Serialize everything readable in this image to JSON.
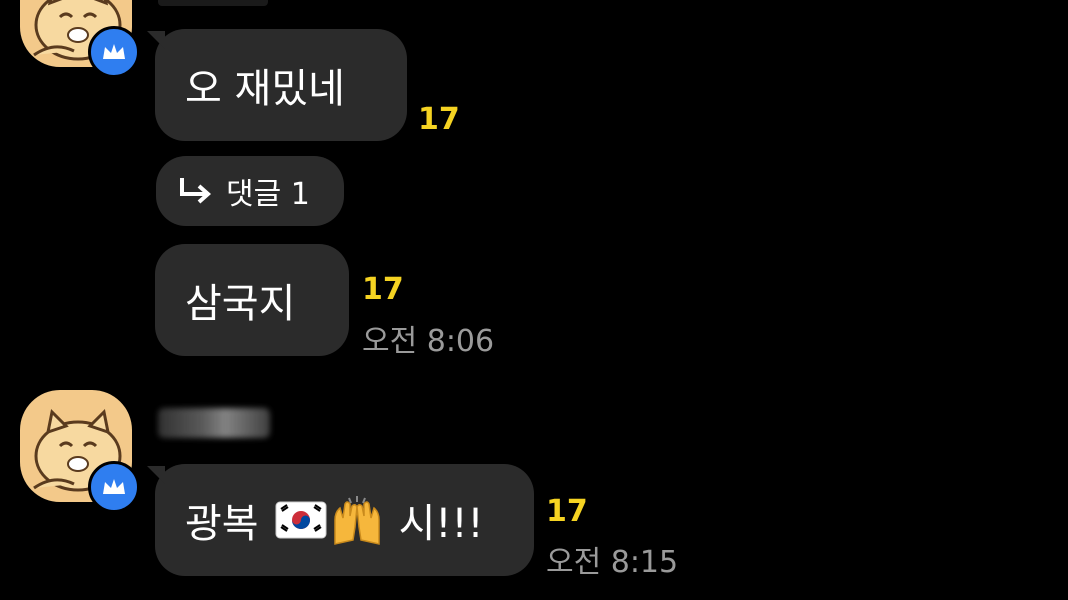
{
  "colors": {
    "background": "#000000",
    "bubble": "#2b2b2b",
    "unread": "#f5d322",
    "badge": "#2f7ef0",
    "avatar": "#f3c98a"
  },
  "messages": [
    {
      "text": "오 재밌네",
      "unread": "17"
    },
    {
      "reply_label": "댓글 1",
      "reply_icon": "reply-arrow-icon"
    },
    {
      "text": "삼국지",
      "unread": "17",
      "time": "오전 8:06"
    }
  ],
  "second_sender": {
    "avatar_icon": "cat-avatar-icon",
    "badge_icon": "crown-icon",
    "message": {
      "text_before": "광복",
      "emojis": [
        "korean-flag-emoji",
        "raised-hands-emoji"
      ],
      "text_after": "시!!!",
      "unread": "17",
      "time": "오전 8:15"
    }
  }
}
